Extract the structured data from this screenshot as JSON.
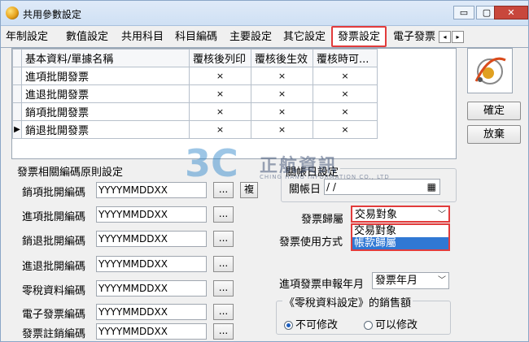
{
  "window": {
    "title": "共用參數設定",
    "controls": {
      "minimize": "▭",
      "restore": "▢",
      "close": "✕"
    }
  },
  "tabs": [
    {
      "label": "年制設定"
    },
    {
      "label": "數值設定"
    },
    {
      "label": "共用科目"
    },
    {
      "label": "科目編碼"
    },
    {
      "label": "主要設定"
    },
    {
      "label": "其它設定"
    },
    {
      "label": "發票設定",
      "active": true
    },
    {
      "label": "電子發票"
    }
  ],
  "tab_scroll": {
    "left": "◂",
    "right": "▸"
  },
  "grid": {
    "headers": [
      "基本資料/單據名稱",
      "覆核後列印",
      "覆核後生效",
      "覆核時可..."
    ],
    "rows": [
      {
        "name": "進項批開發票",
        "c1": "×",
        "c2": "×",
        "c3": "×",
        "marker": ""
      },
      {
        "name": "進退批開發票",
        "c1": "×",
        "c2": "×",
        "c3": "×",
        "marker": ""
      },
      {
        "name": "銷項批開發票",
        "c1": "×",
        "c2": "×",
        "c3": "×",
        "marker": ""
      },
      {
        "name": "銷退批開發票",
        "c1": "×",
        "c2": "×",
        "c3": "×",
        "marker": "▶"
      }
    ]
  },
  "side": {
    "confirm": "確定",
    "cancel": "放棄"
  },
  "invoice_code": {
    "section_title": "發票相關編碼原則設定",
    "fields": [
      {
        "label": "銷項批開編碼",
        "value": "YYYYMMDDXX",
        "btn": "...",
        "extra": "複"
      },
      {
        "label": "進項批開編碼",
        "value": "YYYYMMDDXX",
        "btn": "..."
      },
      {
        "label": "銷退批開編碼",
        "value": "YYYYMMDDXX",
        "btn": "..."
      },
      {
        "label": "進退批開編碼",
        "value": "YYYYMMDDXX",
        "btn": "..."
      },
      {
        "label": "零稅資料編碼",
        "value": "YYYYMMDDXX",
        "btn": "..."
      },
      {
        "label": "電子發票編碼",
        "value": "YYYYMMDDXX",
        "btn": "..."
      },
      {
        "label": "發票註銷編碼",
        "value": "YYYYMMDDXX",
        "btn": "..."
      }
    ]
  },
  "closing": {
    "section_title": "關帳日設定",
    "date_label": "關帳日",
    "date_value": " / /",
    "calendar_icon": "▦"
  },
  "invoice_owner": {
    "label": "發票歸屬",
    "value": "交易對象",
    "options": [
      "交易對象",
      "帳款歸屬"
    ],
    "selected_index": 1
  },
  "invoice_method": {
    "label": "發票使用方式"
  },
  "declare_month": {
    "label": "進項發票申報年月",
    "value": "發票年月"
  },
  "zero_tax": {
    "group_title": "《零稅資料設定》的銷售額",
    "options": [
      "不可修改",
      "可以修改"
    ],
    "checked_index": 0
  },
  "watermark": {
    "mark": "3C",
    "name": "正航資訊",
    "en": "CHING HANG INFORMATION CO., LTD"
  },
  "colors": {
    "highlight": "#e23c3c",
    "selection": "#3078d4",
    "watermark": "#2680c8"
  }
}
